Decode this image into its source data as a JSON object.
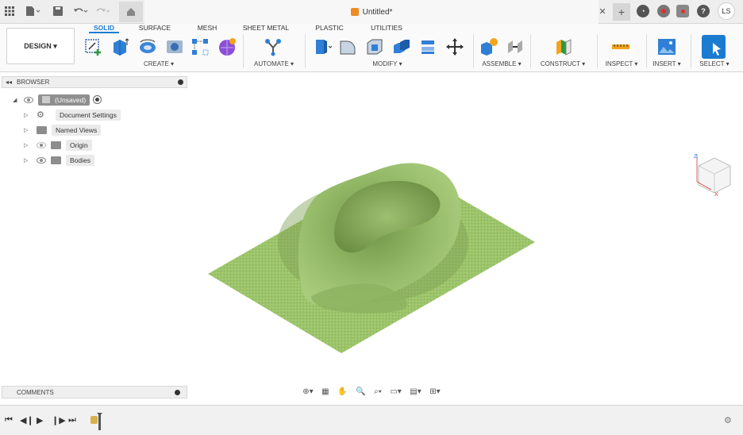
{
  "title_bar": {
    "doc_title": "Untitled*",
    "icons": [
      "apps-grid-icon",
      "file-menu-icon",
      "save-icon",
      "undo-icon",
      "redo-icon",
      "home-icon",
      "close-tab-icon",
      "new-tab-icon",
      "job-status-icon",
      "notifications-icon",
      "extensions-icon",
      "help-icon"
    ],
    "avatar_initials": "LS"
  },
  "toolbar": {
    "workspace_button": "DESIGN ▾",
    "tabs": [
      "SOLID",
      "SURFACE",
      "MESH",
      "SHEET METAL",
      "PLASTIC",
      "UTILITIES"
    ],
    "active_tab": "SOLID",
    "groups": [
      "CREATE ▾",
      "AUTOMATE ▾",
      "MODIFY ▾",
      "ASSEMBLE ▾",
      "CONSTRUCT ▾",
      "INSPECT ▾",
      "INSERT ▾",
      "SELECT ▾"
    ],
    "accent_color": "#1a7bd1"
  },
  "browser": {
    "title": "BROWSER",
    "items": [
      {
        "label": "(Unsaved)",
        "icon": "component-icon"
      },
      {
        "label": "Document Settings",
        "icon": "gear-icon"
      },
      {
        "label": "Named Views",
        "icon": "folder-icon"
      },
      {
        "label": "Origin",
        "icon": "folder-icon"
      },
      {
        "label": "Bodies",
        "icon": "folder-icon"
      }
    ]
  },
  "comments": {
    "title": "COMMENTS"
  },
  "viewcube": {
    "axis_z": "Z",
    "axis_x": "X"
  },
  "model": {
    "surface_color": "#9cc46a",
    "terrain_color": "#7fa553"
  }
}
